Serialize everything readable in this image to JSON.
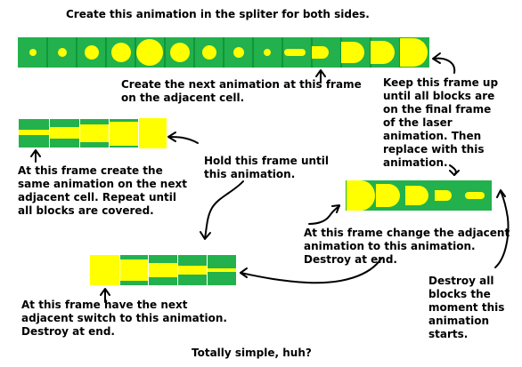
{
  "colors": {
    "green": "#22b14c",
    "yellow": "#ffff00",
    "text": "#000000",
    "arrow": "#000000"
  },
  "text": {
    "title": "Create this animation in the spliter for both sides.",
    "next_animation": "Create the next animation at this frame\non the adjacent cell.",
    "keep_frame": "Keep this frame up\nuntil all blocks are\non the final frame\nof the laser\nanimation. Then\nreplace with this\nanimation.",
    "create_same": "At this frame create the\nsame animation on the next\nadjacent cell. Repeat until\nall blocks are covered.",
    "hold_frame": "Hold this frame until\nthis animation.",
    "change_adjacent": "At this frame change the adjacent\nanimation to this animation.\nDestroy at end.",
    "destroy_all": "Destroy all\nblocks the\nmoment this\nanimation\nstarts.",
    "next_switch": "At this frame have the next\nadjacent switch to this animation.\nDestroy at end.",
    "footer": "Totally simple, huh?"
  }
}
